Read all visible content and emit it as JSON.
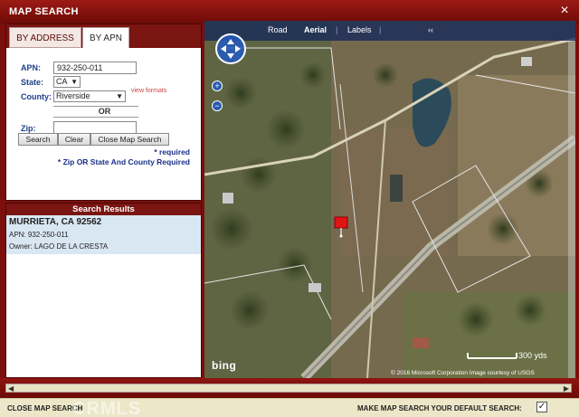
{
  "window": {
    "title": "MAP SEARCH",
    "close_glyph": "×"
  },
  "tabs": {
    "by_address": "BY ADDRESS",
    "by_apn": "BY APN"
  },
  "form": {
    "apn_label": "APN:",
    "apn_value": "932-250-011",
    "state_label": "State:",
    "state_value": "CA",
    "county_label": "County:",
    "county_value": "Riverside",
    "view_formats": "view formats",
    "or_label": "OR",
    "zip_label": "Zip:",
    "zip_value": "",
    "search_button": "Search",
    "clear_button": "Clear",
    "close_button": "Close Map Search",
    "required_note": "* required",
    "zip_note": "* Zip OR State And County Required"
  },
  "results": {
    "header": "Search Results",
    "items": [
      {
        "city": "MURRIETA, CA  92562",
        "apn": "APN: 932-250-011",
        "owner": "Owner: LAGO DE LA CRESTA"
      }
    ]
  },
  "map": {
    "view_road": "Road",
    "view_aerial": "Aerial",
    "view_labels": "Labels",
    "collapse": "‹‹",
    "separator": "|",
    "zoom_in": "+",
    "zoom_out": "−",
    "scale": "300 yds",
    "copyright": "© 2016 Microsoft Corporation    Image courtesy of USGS",
    "logo": "bing",
    "icons": {
      "navigate": "compass-icon",
      "pin": "map-pin-icon"
    }
  },
  "footer": {
    "close_map": "CLOSE MAP SEARCH",
    "watermark": "CRMLS",
    "default_label": "MAKE MAP SEARCH YOUR DEFAULT SEARCH:",
    "default_checked": "✓"
  },
  "colors": {
    "accent": "#7a0f0c",
    "label_blue": "#1e3f8a",
    "result_bg": "#d9e7f3"
  }
}
